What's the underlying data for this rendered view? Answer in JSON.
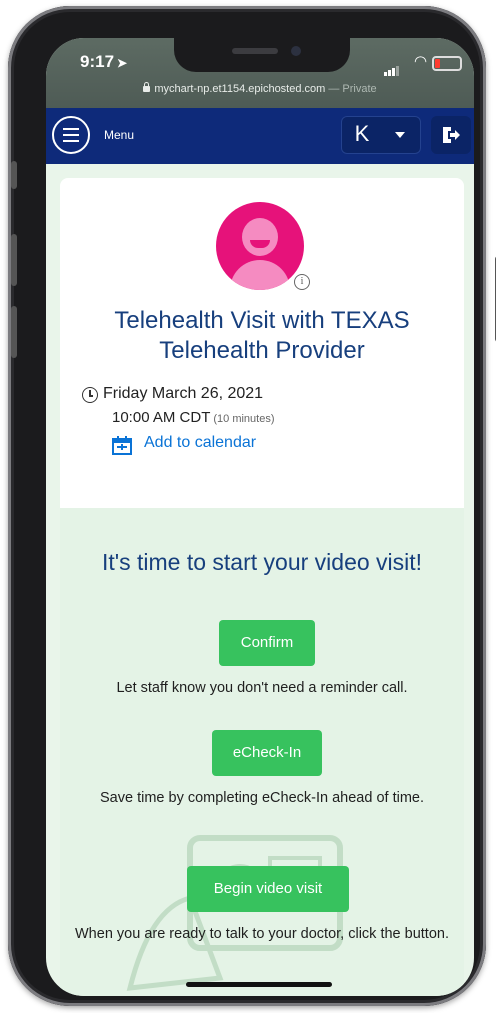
{
  "status_bar": {
    "time": "9:17",
    "url": "mychart-np.et1154.epichosted.com",
    "url_suffix": "— Private"
  },
  "app_bar": {
    "menu_label": "Menu",
    "user_initial": "K"
  },
  "visit": {
    "title": "Telehealth Visit with TEXAS Telehealth Provider",
    "date": "Friday March 26, 2021",
    "time": "10:00 AM CDT",
    "duration": "(10 minutes)",
    "add_to_calendar": "Add to calendar"
  },
  "actions": {
    "heading": "It's time to start your video visit!",
    "confirm_label": "Confirm",
    "confirm_note": "Let staff know you don't need a reminder call.",
    "echeckin_label": "eCheck-In",
    "echeckin_note": "Save time by completing eCheck-In ahead of time.",
    "begin_label": "Begin video visit",
    "begin_note": "When you are ready to talk to your doctor, click the button."
  },
  "colors": {
    "app_bar": "#0e2a7a",
    "title": "#173f7d",
    "button_green": "#37c25e",
    "link_blue": "#0a73d6",
    "avatar": "#e6127a",
    "section_bg": "#e4f3e6"
  },
  "icons": [
    "hamburger-menu-icon",
    "chevron-down-icon",
    "logout-icon",
    "info-icon",
    "clock-icon",
    "calendar-add-icon",
    "lock-icon",
    "wifi-icon",
    "battery-icon",
    "signal-icon",
    "location-arrow-icon"
  ]
}
